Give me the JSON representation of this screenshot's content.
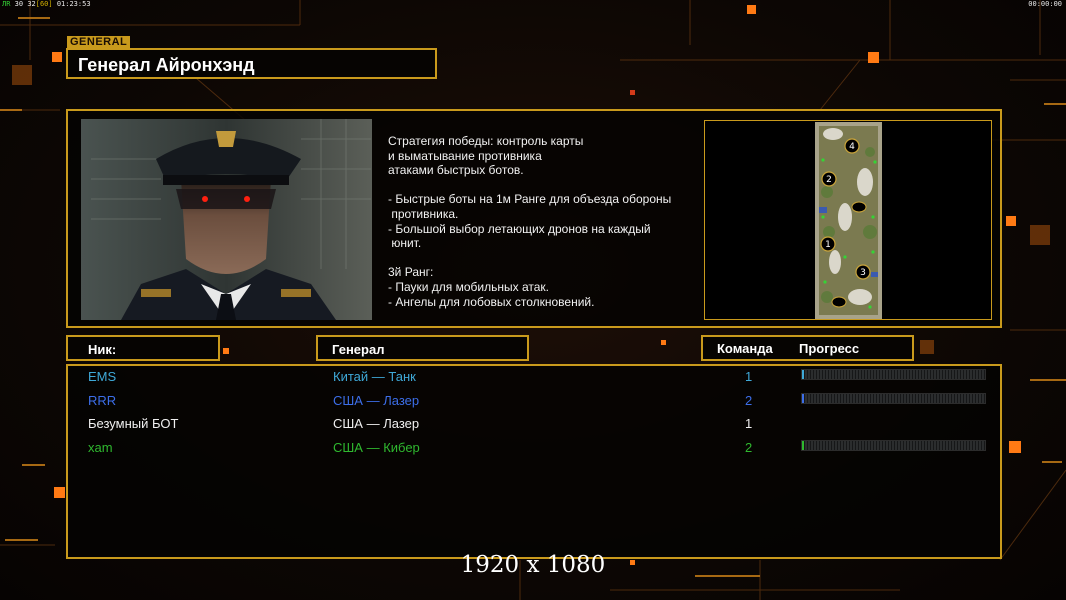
{
  "hud": {
    "fps_label": "ЛR",
    "fps": "30",
    "frames": "32",
    "limit": "[60]",
    "clock": "01:23:53",
    "timer": "00:00:00"
  },
  "general_label": "GENERAL",
  "title": "Генерал Айронхэнд",
  "description": [
    "Стратегия победы: контроль карты",
    "и выматывание противника",
    "атаками быстрых ботов.",
    "",
    "- Быстрые боты на 1м Ранге для объезда обороны",
    " противника.",
    "- Большой выбор летающих дронов на каждый",
    " юнит.",
    "",
    "3й Ранг:",
    "- Пауки для мобильных атак.",
    "- Ангелы для лобовых столкновений."
  ],
  "map": {
    "spawns": [
      "4",
      "2",
      "1",
      "3"
    ]
  },
  "headers": {
    "nick": "Ник:",
    "general": "Генерал",
    "team": "Команда",
    "progress": "Прогресс"
  },
  "players": [
    {
      "nick": "EMS",
      "general": "Китай — Танк",
      "team": "1",
      "color": "#3fa9d8",
      "progress": 0.01,
      "fill": "#3fa9d8"
    },
    {
      "nick": "RRR",
      "general": "США — Лазер",
      "team": "2",
      "color": "#3c6ee8",
      "progress": 0.0,
      "fill": "#3c6ee8"
    },
    {
      "nick": "Безумный БОТ",
      "general": "США — Лазер",
      "team": "1",
      "color": "#f0f0f0",
      "progress": null,
      "fill": ""
    },
    {
      "nick": "xam",
      "general": "США — Кибер",
      "team": "2",
      "color": "#2fb82f",
      "progress": 0.01,
      "fill": "#2fb82f"
    }
  ],
  "resolution": "1920 x 1080",
  "colors": {
    "gold": "#c99a1c",
    "accent": "#ff7a14"
  }
}
